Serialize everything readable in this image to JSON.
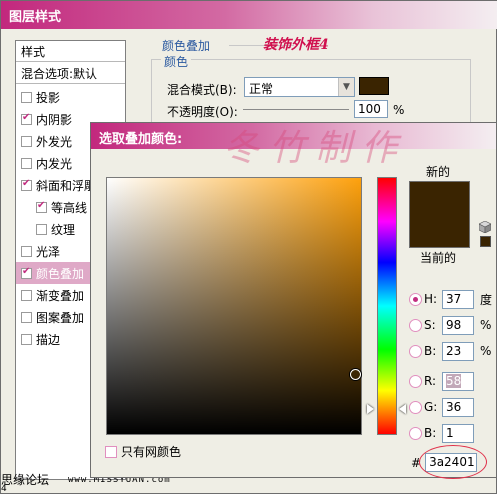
{
  "layer_style": {
    "title": "图层样式",
    "styles_header": "样式",
    "blend_options": "混合选项:默认",
    "items": [
      {
        "label": "投影",
        "checked": false,
        "sub": false,
        "selected": false
      },
      {
        "label": "内阴影",
        "checked": true,
        "sub": false,
        "selected": false
      },
      {
        "label": "外发光",
        "checked": false,
        "sub": false,
        "selected": false
      },
      {
        "label": "内发光",
        "checked": false,
        "sub": false,
        "selected": false
      },
      {
        "label": "斜面和浮雕",
        "checked": true,
        "sub": false,
        "selected": false
      },
      {
        "label": "等高线",
        "checked": true,
        "sub": true,
        "selected": false
      },
      {
        "label": "纹理",
        "checked": false,
        "sub": true,
        "selected": false
      },
      {
        "label": "光泽",
        "checked": false,
        "sub": false,
        "selected": false
      },
      {
        "label": "颜色叠加",
        "checked": true,
        "sub": false,
        "selected": true
      },
      {
        "label": "渐变叠加",
        "checked": false,
        "sub": false,
        "selected": false
      },
      {
        "label": "图案叠加",
        "checked": false,
        "sub": false,
        "selected": false
      },
      {
        "label": "描边",
        "checked": false,
        "sub": false,
        "selected": false
      }
    ],
    "section_title": "颜色叠加",
    "watermark_title": "装饰外框4",
    "group_title": "颜色",
    "blend_mode_label": "混合模式(B):",
    "blend_mode_value": "正常",
    "opacity_label": "不透明度(O):",
    "opacity_value": "100",
    "opacity_unit": "%",
    "overlay_color": "#3a2401",
    "footer_text": "思缘论坛",
    "footer_url": "www.MISSYUAN.com",
    "footer_mark": "4"
  },
  "color_picker": {
    "title": "选取叠加颜色:",
    "watermark": "冬竹制作",
    "new_label": "新的",
    "current_label": "当前的",
    "new_color": "#3a2401",
    "current_color": "#3a2401",
    "web_only_label": "只有网颜色",
    "fields": [
      {
        "label": "H:",
        "value": "37",
        "unit": "度",
        "selected": true,
        "disabled": false
      },
      {
        "label": "S:",
        "value": "98",
        "unit": "%",
        "selected": false,
        "disabled": false
      },
      {
        "label": "B:",
        "value": "23",
        "unit": "%",
        "selected": false,
        "disabled": false
      },
      {
        "label": "R:",
        "value": "58",
        "unit": "",
        "selected": false,
        "disabled": true
      },
      {
        "label": "G:",
        "value": "36",
        "unit": "",
        "selected": false,
        "disabled": false
      },
      {
        "label": "B:",
        "value": "1",
        "unit": "",
        "selected": false,
        "disabled": false
      }
    ],
    "hex_label": "#",
    "hex_value": "3a2401",
    "hue_color": "#fea10d",
    "icons": {
      "cube": "cube-icon",
      "chevron": "chevron-down-icon"
    }
  }
}
